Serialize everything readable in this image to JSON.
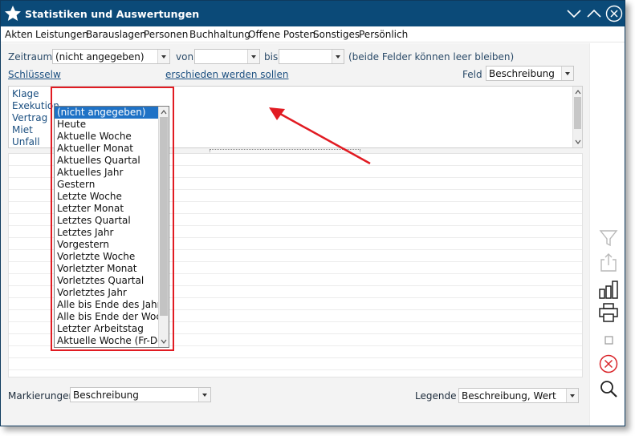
{
  "window": {
    "title": "Statistiken und Auswertungen"
  },
  "menu": [
    "Akten",
    "Leistungen",
    "Barauslagen",
    "Personen",
    "Buchhaltung",
    "Offene Posten",
    "Sonstiges",
    "Persönlich"
  ],
  "filter": {
    "zeitraum_label": "Zeitraum:",
    "zeitraum_value": "(nicht angegeben)",
    "von_label": "von",
    "von_value": "",
    "bis_label": "bis",
    "bis_value": "",
    "hint": "(beide Felder können leer bleiben)",
    "schluessel_link_left": "Schlüsselw",
    "schluessel_link_right": "erschieden werden sollen",
    "feld_label": "Feld",
    "feld_value": "Beschreibung"
  },
  "keywords": [
    "Klage",
    "Exekution",
    "Vertrag",
    "Miet",
    "Unfall"
  ],
  "dropdown": {
    "options": [
      "(nicht angegeben)",
      "Heute",
      "Aktuelle Woche",
      "Aktueller Monat",
      "Aktuelles Quartal",
      "Aktuelles Jahr",
      "Gestern",
      "Letzte Woche",
      "Letzter Monat",
      "Letztes Quartal",
      "Letztes Jahr",
      "Vorgestern",
      "Vorletzte Woche",
      "Vorletzter Monat",
      "Vorletztes Quartal",
      "Vorletztes Jahr",
      "Alle bis Ende des Jahres",
      "Alle bis Ende der Woche",
      "Letzter Arbeitstag",
      "Aktuelle Woche (Fr-Do)"
    ],
    "selected_index": 0
  },
  "bottom": {
    "markierungen_label": "Markierungen",
    "markierungen_value": "Beschreibung",
    "legende_label": "Legende",
    "legende_value": "Beschreibung, Wert"
  },
  "colors": {
    "titlebar": "#0b4a78",
    "highlight": "#e11b22",
    "selection": "#1f72c6"
  },
  "sidebar_icons": [
    "filter-icon",
    "export-icon",
    "chart-icon",
    "print-icon",
    "square-icon",
    "cancel-icon",
    "search-icon"
  ]
}
